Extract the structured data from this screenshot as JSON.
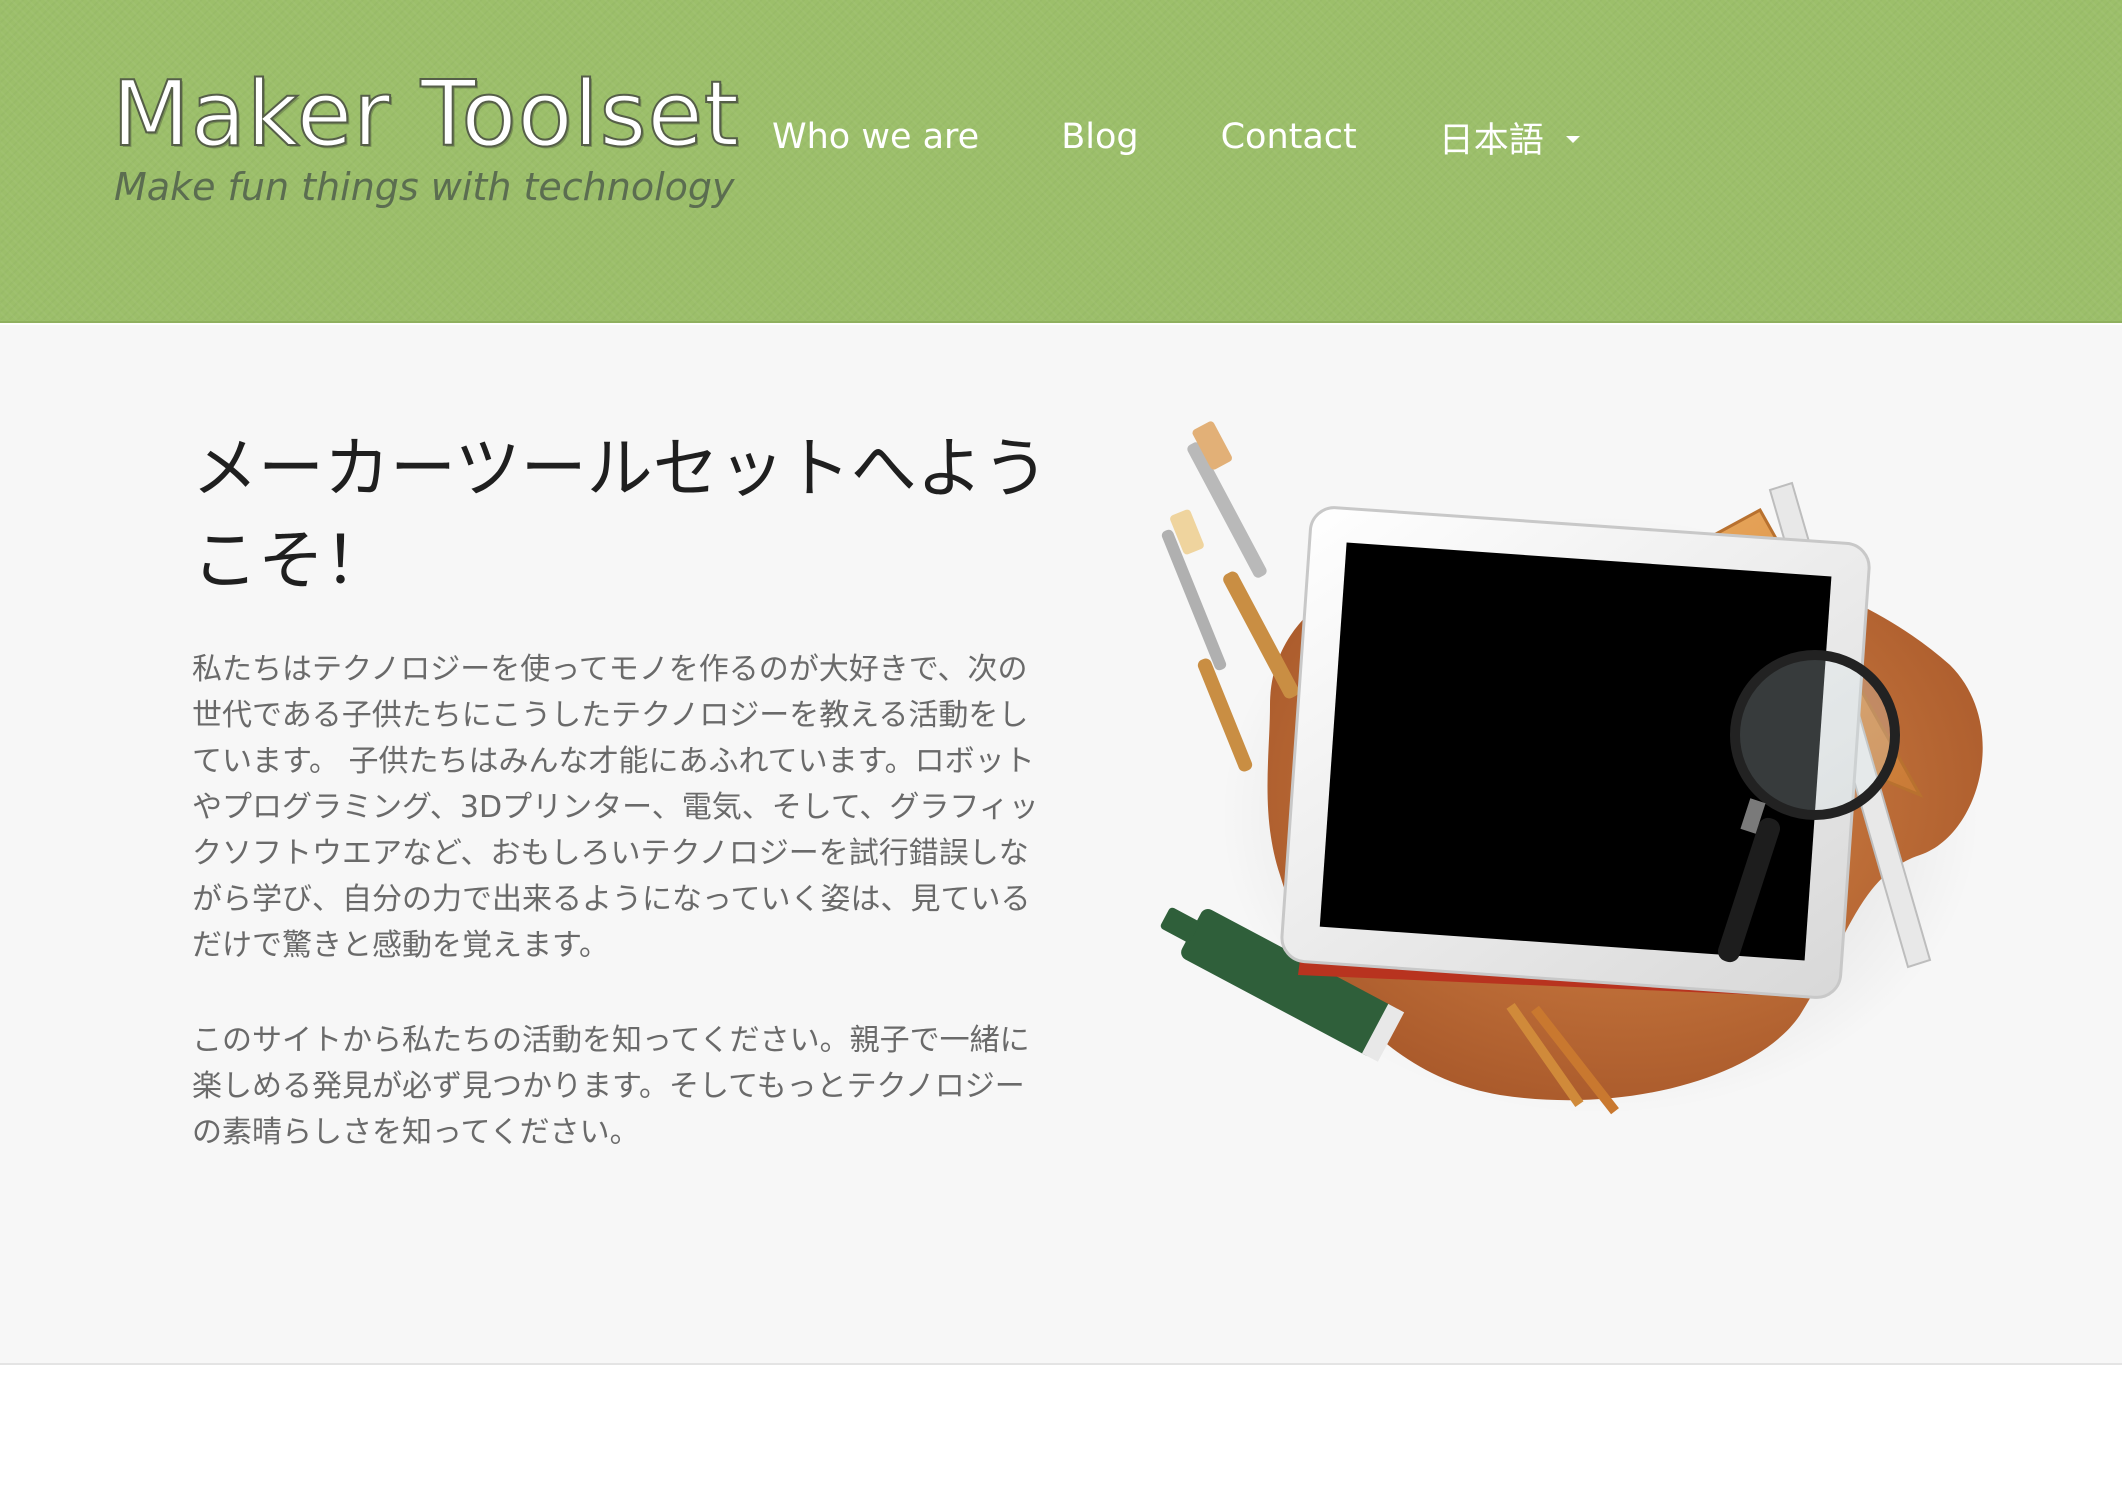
{
  "header": {
    "site_title": "Maker Toolset",
    "tagline": "Make fun things with technology",
    "background_color": "#9cbf6a"
  },
  "nav": {
    "items": [
      {
        "label": "Who we are"
      },
      {
        "label": "Blog"
      },
      {
        "label": "Contact"
      },
      {
        "label": "日本語",
        "icon": "caret-down-icon"
      }
    ]
  },
  "main": {
    "title": "メーカーツールセットへようこそ！",
    "paragraphs": [
      "私たちはテクノロジーを使ってモノを作るのが大好きで、次の世代である子供たちにこうしたテクノロジーを教える活動をしています。 子供たちはみんな才能にあふれています。ロボットやプログラミング、3Dプリンター、電気、そして、グラフィックソフトウエアなど、おもしろいテクノロジーを試行錯誤しながら学び、自分の力で出来るようになっていく姿は、見ているだけで驚きと感動を覚えます。",
      "このサイトから私たちの活動を知ってください。親子で一緒に楽しめる発見が必ず見つかります。そしてもっとテクノロジーの素晴らしさを知ってください。"
    ],
    "illustration": "tablet-with-art-tools-image"
  }
}
